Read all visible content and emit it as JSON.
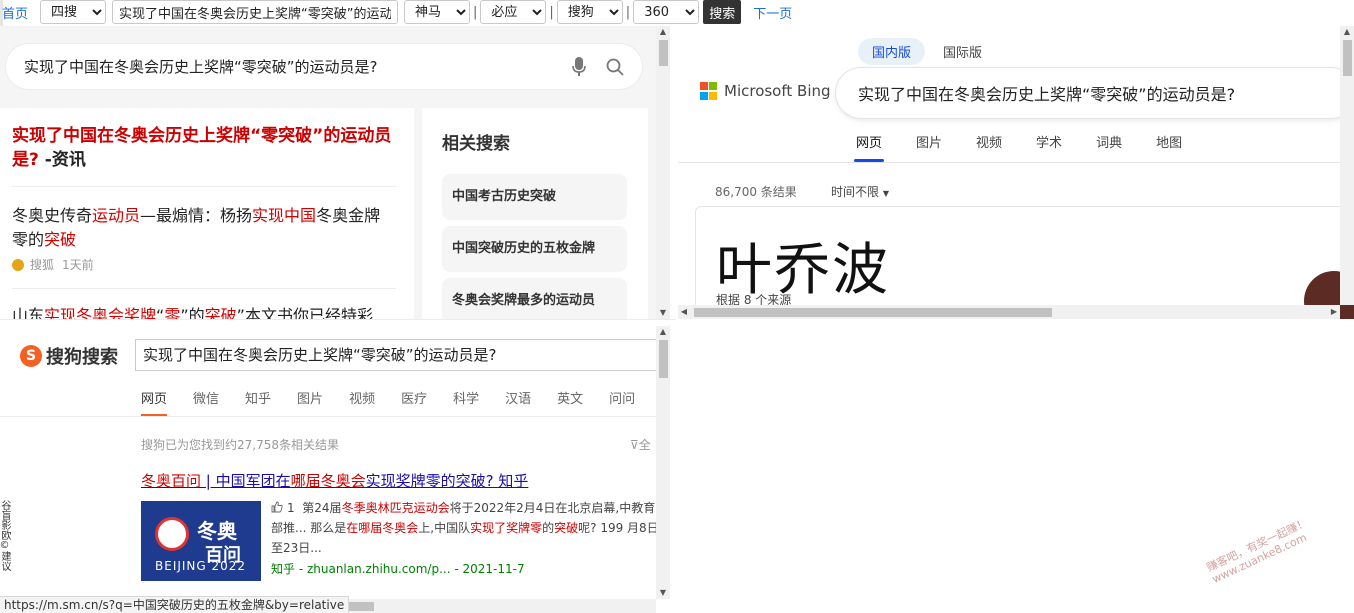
{
  "toolbar": {
    "home": "首页",
    "engine_group": "四搜",
    "query": "实现了中国在冬奥会历史上奖牌“零突破”的运动员是?",
    "engines": [
      "神马",
      "必应",
      "搜狗",
      "360"
    ],
    "search_button": "搜索",
    "next_page": "下一页"
  },
  "sm": {
    "query": "实现了中国在冬奥会历史上奖牌“零突破”的运动员是?",
    "results": [
      {
        "title_red": "实现了中国在冬奥会历史上奖牌“零突破”的运动员是?",
        "title_plain": " -资讯"
      },
      {
        "pre": "冬奥史传奇",
        "r1": "运动员",
        "mid": "—最煽情：杨扬",
        "r2": "实现中国",
        "mid2": "冬奥金牌零的",
        "r3": "突破",
        "source": "搜狐",
        "time": "1天前"
      },
      {
        "pre": "山东",
        "r1": "实现冬奥会奖牌",
        "mid": "“",
        "r2": "零",
        "mid2": "”的",
        "r3": "突破",
        "post": "”本文书你已经特彩"
      }
    ],
    "related_heading": "相关搜索",
    "related": [
      "中国考古历史突破",
      "中国突破历史的五枚金牌",
      "冬奥会奖牌最多的运动员"
    ]
  },
  "bing": {
    "scopes": [
      "国内版",
      "国际版"
    ],
    "logo": "Microsoft Bing",
    "query": "实现了中国在冬奥会历史上奖牌“零突破”的运动员是?",
    "tabs": [
      "网页",
      "图片",
      "视频",
      "学术",
      "词典",
      "地图"
    ],
    "count": "86,700 条结果",
    "time_filter": "时间不限",
    "answer": "叶乔波",
    "answer_source": "根据 8 个来源",
    "colors": {
      "accent": "#174ae4",
      "ms_red": "#f25022",
      "ms_green": "#7fba00",
      "ms_blue": "#00a4ef",
      "ms_yellow": "#ffb900"
    }
  },
  "sogou": {
    "logo": "搜狗搜索",
    "query": "实现了中国在冬奥会历史上奖牌“零突破”的运动员是?",
    "tabs": [
      "网页",
      "微信",
      "知乎",
      "图片",
      "视频",
      "医疗",
      "科学",
      "汉语",
      "英文",
      "问问"
    ],
    "count": "搜狗已为您找到约27,758条相关结果",
    "filter": "全",
    "result": {
      "title_red": "冬奥百问",
      "title_mid": " | 中国军团在",
      "title_red2": "哪届冬奥会",
      "title_mid2": "实现奖牌零的突破? 知乎",
      "thumb_line1": "冬奥",
      "thumb_line2": "百问",
      "thumb_brand": "BEIJING 2022",
      "likes": "1",
      "snippet_a": "第24届",
      "snippet_r1": "冬季奥林匹克运动会",
      "snippet_b": "将于2022年2月4日在北京启幕,中教育部推... 那么是",
      "snippet_r2": "在哪届冬奥会",
      "snippet_c": "上,中国队",
      "snippet_r3": "实现了奖牌零",
      "snippet_d": "的",
      "snippet_r4": "突破",
      "snippet_e": "呢? 199 月8日至23日...",
      "url": "知乎 - zhuanlan.zhihu.com/p... - 2021-11-7"
    }
  },
  "status_url": "https://m.sm.cn/s?q=中国突破历史的五枚金牌&by=relative",
  "side_text": "谷盲影欧©建议",
  "watermark": "赚客吧，有奖一起赚！\nwww.zuanke8.com"
}
